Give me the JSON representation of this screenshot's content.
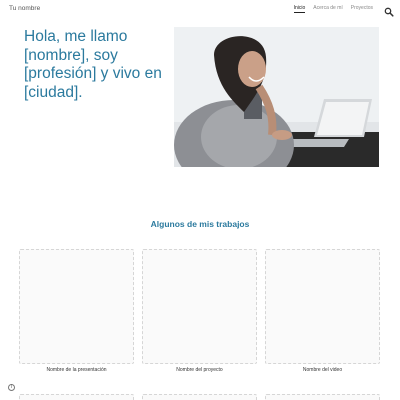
{
  "header": {
    "site_name": "Tu nombre",
    "nav": [
      "Inicio",
      "Acerca de mí",
      "Proyectos"
    ],
    "active_nav": "Inicio",
    "search_icon": "search-icon"
  },
  "hero": {
    "title": "Hola, me llamo [nombre], soy [profesión] y vivo en [ciudad]."
  },
  "projects": {
    "title": "Algunos de mis trabajos",
    "items": [
      "Nombre de la presentación",
      "Nombre del proyecto",
      "Nombre del video"
    ]
  },
  "info_icon": "info-icon",
  "colors": {
    "accent": "#2b7a9e",
    "card_bg": "#fafafa",
    "card_border": "#d6d6d6"
  }
}
